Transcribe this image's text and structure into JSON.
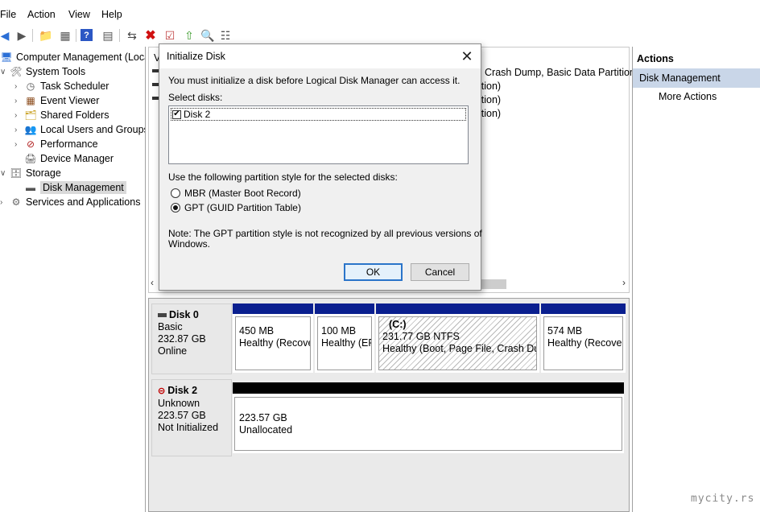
{
  "menu": [
    "File",
    "Action",
    "View",
    "Help"
  ],
  "toolbar": {
    "icons": [
      "back-arrow-icon",
      "forward-arrow-icon",
      "up-folder-icon",
      "show-hide-tree-icon",
      "help-icon",
      "properties-icon",
      "connect-icon",
      "delete-icon",
      "check-icon",
      "import-icon",
      "search-icon",
      "settings-icon"
    ]
  },
  "tree": {
    "root": "Computer Management (Local",
    "system_tools": "System Tools",
    "task_scheduler": "Task Scheduler",
    "event_viewer": "Event Viewer",
    "shared_folders": "Shared Folders",
    "local_users": "Local Users and Groups",
    "performance": "Performance",
    "device_manager": "Device Manager",
    "storage": "Storage",
    "disk_management": "Disk Management",
    "services": "Services and Applications"
  },
  "volumes": {
    "header_fragment": "V",
    "rows": [
      "Crash Dump, Basic Data Partition)",
      "ition)",
      "ition)",
      "ition)"
    ]
  },
  "disks": {
    "disk0": {
      "name": "Disk 0",
      "type": "Basic",
      "size": "232.87 GB",
      "status": "Online",
      "partitions": [
        {
          "label": "",
          "size": "450 MB",
          "status": "Healthy (Recove"
        },
        {
          "label": "",
          "size": "100 MB",
          "status": "Healthy (EF"
        },
        {
          "label": "(C:)",
          "size": "231.77 GB NTFS",
          "status": "Healthy (Boot, Page File, Crash Dum"
        },
        {
          "label": "",
          "size": "574 MB",
          "status": "Healthy (Recover"
        }
      ]
    },
    "disk2": {
      "name": "Disk 2",
      "type": "Unknown",
      "size": "223.57 GB",
      "status": "Not Initialized",
      "unallocated_size": "223.57 GB",
      "unallocated_label": "Unallocated"
    }
  },
  "actions": {
    "header": "Actions",
    "section": "Disk Management",
    "more": "More Actions"
  },
  "dialog": {
    "title": "Initialize Disk",
    "intro": "You must initialize a disk before Logical Disk Manager can access it.",
    "select_label": "Select disks:",
    "disk_item": "Disk 2",
    "disk_checked": true,
    "style_label": "Use the following partition style for the selected disks:",
    "mbr": "MBR (Master Boot Record)",
    "gpt": "GPT (GUID Partition Table)",
    "selected_style": "GPT",
    "note_line1": "Note: The GPT partition style is not recognized by all previous versions of",
    "note_line2": "Windows.",
    "ok": "OK",
    "cancel": "Cancel"
  },
  "watermark": "mycity.rs",
  "colors": {
    "partition_bar": "#0a1f8f",
    "unallocated_bar": "#000000",
    "action_section_bg": "#c9d6e8",
    "ok_border": "#2a74c9"
  }
}
